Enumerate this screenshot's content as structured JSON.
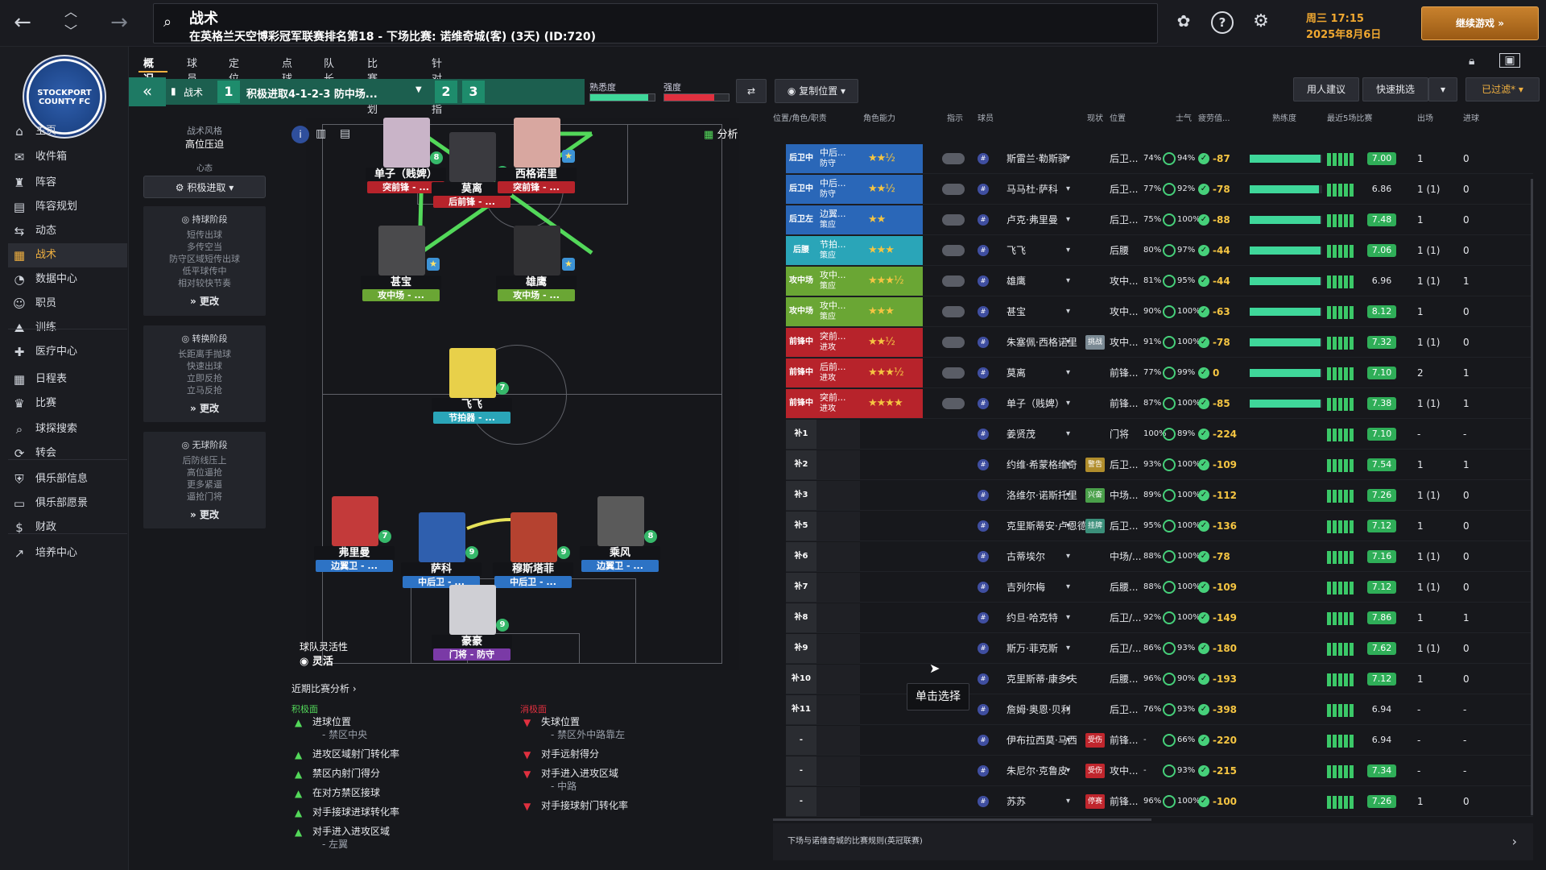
{
  "header": {
    "title": "战术",
    "subtitle": "在英格兰天空博彩冠军联赛排名第18 - 下场比赛: 诺维奇城(客) (3天) (ID:720)",
    "date_line1": "周三 17:15",
    "date_line2": "2025年8月6日",
    "continue_label": "继续游戏"
  },
  "club": {
    "crest_text": "STOCKPORT COUNTY FC"
  },
  "sidebar": {
    "items": [
      {
        "label": "主页",
        "icon": "home-icon"
      },
      {
        "label": "收件箱",
        "icon": "inbox-icon"
      },
      {
        "label": "阵容",
        "icon": "shirt-icon"
      },
      {
        "label": "阵容规划",
        "icon": "clipboard-icon"
      },
      {
        "label": "动态",
        "icon": "dynamics-icon"
      },
      {
        "label": "战术",
        "icon": "tactics-icon"
      },
      {
        "label": "数据中心",
        "icon": "data-icon"
      },
      {
        "label": "职员",
        "icon": "staff-icon"
      },
      {
        "label": "训练",
        "icon": "training-icon"
      },
      {
        "label": "医疗中心",
        "icon": "medical-icon"
      },
      {
        "label": "日程表",
        "icon": "calendar-icon"
      },
      {
        "label": "比赛",
        "icon": "trophy-icon"
      },
      {
        "label": "球探搜索",
        "icon": "search-icon"
      },
      {
        "label": "转会",
        "icon": "transfer-icon"
      },
      {
        "label": "俱乐部信息",
        "icon": "shield-icon"
      },
      {
        "label": "俱乐部愿景",
        "icon": "vision-icon"
      },
      {
        "label": "财政",
        "icon": "finance-icon"
      },
      {
        "label": "培养中心",
        "icon": "development-icon"
      }
    ]
  },
  "tabs": [
    "概况",
    "球员",
    "定位球",
    "点球",
    "队长",
    "比赛计划",
    "针对性指令"
  ],
  "toolbar": {
    "tactic_label": "战术",
    "tactic_name": "积极进取4-1-2-3 防中场...",
    "slot1": "1",
    "slot2": "2",
    "slot3": "3",
    "familiarity_label": "熟悉度",
    "familiarity_level": 0.9,
    "intensity_label": "强度",
    "intensity_level": 0.78,
    "copy_position": "复制位置",
    "advice": "用人建议",
    "quick_pick": "快速挑选",
    "filtered": "已过滤*"
  },
  "tactic_panel": {
    "style_label": "战术风格",
    "style_value": "高位压迫",
    "mentality_label": "心态",
    "mentality_value": "积极进取",
    "in_possession_title": "持球阶段",
    "in_possession": [
      "短传出球",
      "多传空当",
      "防守区域短传出球",
      "低平球传中",
      "相对较快节奏"
    ],
    "transition_title": "转换阶段",
    "transition": [
      "长距离手抛球",
      "快速出球",
      "立即反抢",
      "立马反抢"
    ],
    "out_possession_title": "无球阶段",
    "out_possession": [
      "后防线压上",
      "高位逼抢",
      "更多紧逼",
      "逼抢门将"
    ],
    "more": "更改"
  },
  "pitch": {
    "analysis_label": "分析",
    "flex_label": "球队灵活性",
    "flex_value": "灵活",
    "players": [
      {
        "name": "单子（贱婢）",
        "role": "突前锋 - ...",
        "rating": "8",
        "role_color": "#b7232b"
      },
      {
        "name": "莫离",
        "role": "后前锋 - ...",
        "rating": "8",
        "role_color": "#b7232b"
      },
      {
        "name": "西格诺里",
        "role": "突前锋 - ...",
        "rating": "",
        "role_color": "#b7232b"
      },
      {
        "name": "甚宝",
        "role": "攻中场 - ...",
        "rating": "",
        "role_color": "#6aa634"
      },
      {
        "name": "雄鹰",
        "role": "攻中场 - ...",
        "rating": "",
        "role_color": "#6aa634"
      },
      {
        "name": "飞飞",
        "role": "节拍器 - ...",
        "rating": "7",
        "role_color": "#2aa5b8"
      },
      {
        "name": "弗里曼",
        "role": "边翼卫 - ...",
        "rating": "7",
        "role_color": "#2d73c5"
      },
      {
        "name": "萨科",
        "role": "中后卫 - ...",
        "rating": "9",
        "role_color": "#2d73c5"
      },
      {
        "name": "穆斯塔菲",
        "role": "中后卫 - ...",
        "rating": "9",
        "role_color": "#2d73c5"
      },
      {
        "name": "乘风",
        "role": "边翼卫 - ...",
        "rating": "8",
        "role_color": "#2d73c5"
      },
      {
        "name": "豪豪",
        "role": "门将 - 防守",
        "rating": "9",
        "role_color": "#7a3aa6"
      }
    ]
  },
  "analysis": {
    "title": "近期比赛分析",
    "positive_title": "积极面",
    "negative_title": "消极面",
    "positive": [
      {
        "text": "进球位置",
        "sub": "- 禁区中央"
      },
      {
        "text": "进攻区域射门转化率",
        "sub": ""
      },
      {
        "text": "禁区内射门得分",
        "sub": ""
      },
      {
        "text": "在对方禁区接球",
        "sub": ""
      },
      {
        "text": "对手接球进球转化率",
        "sub": ""
      },
      {
        "text": "对手进入进攻区域",
        "sub": "- 左翼"
      }
    ],
    "negative": [
      {
        "text": "失球位置",
        "sub": "- 禁区外中路靠左"
      },
      {
        "text": "对手远射得分",
        "sub": ""
      },
      {
        "text": "对手进入进攻区域",
        "sub": "- 中路"
      },
      {
        "text": "对手接球射门转化率",
        "sub": ""
      }
    ]
  },
  "table": {
    "headers": {
      "position": "位置/角色/职责",
      "ability": "角色能力",
      "instr": "指示",
      "player": "球员",
      "status": "现状",
      "pos": "位置",
      "morale": "士气",
      "condition": "疲劳值...",
      "familiar": "熟练度",
      "last5": "最近5场比赛",
      "apps": "出场",
      "goals": "进球"
    },
    "rows": [
      {
        "slot": "后卫中右",
        "role": "中后...",
        "duty": "防守",
        "stars": "★★½",
        "player": "斯雷兰·勒斯驿",
        "tag": "",
        "pos": "后卫...",
        "p1": "74%",
        "p2": "94%",
        "form": "-87",
        "rating": "7.00",
        "apps": "1",
        "goals": "0",
        "slot_color": "#2a67b8",
        "fam": 0.98
      },
      {
        "slot": "后卫中左",
        "role": "中后...",
        "duty": "防守",
        "stars": "★★½",
        "player": "马马杜·萨科",
        "tag": "",
        "pos": "后卫...",
        "p1": "77%",
        "p2": "92%",
        "form": "-78",
        "rating": "6.86",
        "apps": "1 (1)",
        "goals": "0",
        "slot_color": "#2a67b8",
        "fam": 0.96
      },
      {
        "slot": "后卫左",
        "role": "边翼...",
        "duty": "策应",
        "stars": "★★",
        "player": "卢克·弗里曼",
        "tag": "",
        "pos": "后卫...",
        "p1": "75%",
        "p2": "100%",
        "form": "-88",
        "rating": "7.48",
        "apps": "1",
        "goals": "0",
        "slot_color": "#2a67b8",
        "fam": 0.98
      },
      {
        "slot": "后腰",
        "role": "节拍...",
        "duty": "策应",
        "stars": "★★★",
        "player": "飞飞",
        "tag": "",
        "pos": "后腰",
        "p1": "80%",
        "p2": "97%",
        "form": "-44",
        "rating": "7.06",
        "apps": "1 (1)",
        "goals": "0",
        "slot_color": "#2aa5b8",
        "fam": 0.98
      },
      {
        "slot": "攻中场右",
        "role": "攻中...",
        "duty": "策应",
        "stars": "★★★½",
        "player": "雄鹰",
        "tag": "",
        "pos": "攻中...",
        "p1": "81%",
        "p2": "95%",
        "form": "-44",
        "rating": "6.96",
        "apps": "1 (1)",
        "goals": "1",
        "slot_color": "#6aa634",
        "fam": 0.98
      },
      {
        "slot": "攻中场左",
        "role": "攻中...",
        "duty": "策应",
        "stars": "★★★",
        "player": "甚宝",
        "tag": "",
        "pos": "攻中...",
        "p1": "90%",
        "p2": "100%",
        "form": "-63",
        "rating": "8.12",
        "apps": "1",
        "goals": "0",
        "slot_color": "#6aa634",
        "fam": 0.98
      },
      {
        "slot": "前锋中右",
        "role": "突前...",
        "duty": "进攻",
        "stars": "★★½",
        "player": "朱塞佩·西格诺里",
        "tag": "挑战",
        "pos": "攻中...",
        "p1": "91%",
        "p2": "100%",
        "form": "-78",
        "rating": "7.32",
        "apps": "1 (1)",
        "goals": "0",
        "slot_color": "#b7232b",
        "fam": 0.98
      },
      {
        "slot": "前锋中",
        "role": "后前...",
        "duty": "进攻",
        "stars": "★★★½",
        "player": "莫离",
        "tag": "",
        "pos": "前锋...",
        "p1": "77%",
        "p2": "99%",
        "form": "0",
        "rating": "7.10",
        "apps": "2",
        "goals": "1",
        "slot_color": "#b7232b",
        "fam": 0.98
      },
      {
        "slot": "前锋中左",
        "role": "突前...",
        "duty": "进攻",
        "stars": "★★★★",
        "player": "单子（贱婢）",
        "tag": "",
        "pos": "前锋...",
        "p1": "87%",
        "p2": "100%",
        "form": "-85",
        "rating": "7.38",
        "apps": "1 (1)",
        "goals": "1",
        "slot_color": "#b7232b",
        "fam": 0.98
      },
      {
        "slot": "补1",
        "role": "",
        "duty": "",
        "stars": "",
        "player": "姜贤茂",
        "tag": "",
        "pos": "门将",
        "p1": "100%",
        "p2": "89%",
        "form": "-224",
        "rating": "7.10",
        "apps": "-",
        "goals": "-",
        "slot_color": "",
        "fam": 0
      },
      {
        "slot": "补2",
        "role": "",
        "duty": "",
        "stars": "",
        "player": "约维·希蒙格维奇",
        "tag": "警告",
        "pos": "后卫...",
        "p1": "93%",
        "p2": "100%",
        "form": "-109",
        "rating": "7.54",
        "apps": "1",
        "goals": "1",
        "slot_color": "",
        "fam": 0
      },
      {
        "slot": "补3",
        "role": "",
        "duty": "",
        "stars": "",
        "player": "洛维尔·诺斯托里",
        "tag": "兴奋",
        "pos": "中场...",
        "p1": "89%",
        "p2": "100%",
        "form": "-112",
        "rating": "7.26",
        "apps": "1 (1)",
        "goals": "0",
        "slot_color": "",
        "fam": 0
      },
      {
        "slot": "补5",
        "role": "",
        "duty": "",
        "stars": "",
        "player": "克里斯蒂安·卢恩德",
        "tag": "挂牌",
        "pos": "后卫...",
        "p1": "95%",
        "p2": "100%",
        "form": "-136",
        "rating": "7.12",
        "apps": "1",
        "goals": "0",
        "slot_color": "",
        "fam": 0
      },
      {
        "slot": "补6",
        "role": "",
        "duty": "",
        "stars": "",
        "player": "古蒂埃尔",
        "tag": "",
        "pos": "中场/...",
        "p1": "88%",
        "p2": "100%",
        "form": "-78",
        "rating": "7.16",
        "apps": "1 (1)",
        "goals": "0",
        "slot_color": "",
        "fam": 0
      },
      {
        "slot": "补7",
        "role": "",
        "duty": "",
        "stars": "",
        "player": "吉列尔梅",
        "tag": "",
        "pos": "后腰...",
        "p1": "88%",
        "p2": "100%",
        "form": "-109",
        "rating": "7.12",
        "apps": "1 (1)",
        "goals": "0",
        "slot_color": "",
        "fam": 0
      },
      {
        "slot": "补8",
        "role": "",
        "duty": "",
        "stars": "",
        "player": "约旦·哈克特",
        "tag": "",
        "pos": "后卫/...",
        "p1": "92%",
        "p2": "100%",
        "form": "-149",
        "rating": "7.86",
        "apps": "1",
        "goals": "1",
        "slot_color": "",
        "fam": 0
      },
      {
        "slot": "补9",
        "role": "",
        "duty": "",
        "stars": "",
        "player": "斯万·菲克斯",
        "tag": "",
        "pos": "后卫/...",
        "p1": "86%",
        "p2": "93%",
        "form": "-180",
        "rating": "7.62",
        "apps": "1 (1)",
        "goals": "0",
        "slot_color": "",
        "fam": 0
      },
      {
        "slot": "补10",
        "role": "",
        "duty": "",
        "stars": "",
        "player": "克里斯蒂·康多夫",
        "tag": "",
        "pos": "后腰...",
        "p1": "96%",
        "p2": "90%",
        "form": "-193",
        "rating": "7.12",
        "apps": "1",
        "goals": "0",
        "slot_color": "",
        "fam": 0
      },
      {
        "slot": "补11",
        "role": "",
        "duty": "",
        "stars": "",
        "player": "詹姆·奥恩·贝利",
        "tag": "",
        "pos": "后卫...",
        "p1": "76%",
        "p2": "93%",
        "form": "-398",
        "rating": "6.94",
        "apps": "-",
        "goals": "-",
        "slot_color": "",
        "fam": 0
      },
      {
        "slot": "-",
        "role": "",
        "duty": "",
        "stars": "",
        "player": "伊布拉西莫·马西",
        "tag": "受伤",
        "pos": "前锋...",
        "p1": "-",
        "p2": "66%",
        "form": "-220",
        "rating": "6.94",
        "apps": "-",
        "goals": "-",
        "slot_color": "",
        "fam": 0
      },
      {
        "slot": "-",
        "role": "",
        "duty": "",
        "stars": "",
        "player": "朱尼尔·克鲁皮",
        "tag": "受伤",
        "pos": "攻中...",
        "p1": "-",
        "p2": "93%",
        "form": "-215",
        "rating": "7.34",
        "apps": "-",
        "goals": "-",
        "slot_color": "",
        "fam": 0
      },
      {
        "slot": "-",
        "role": "",
        "duty": "",
        "stars": "",
        "player": "苏苏",
        "tag": "停赛",
        "pos": "前锋...",
        "p1": "96%",
        "p2": "100%",
        "form": "-100",
        "rating": "7.26",
        "apps": "1",
        "goals": "0",
        "slot_color": "",
        "fam": 0
      }
    ]
  },
  "tooltip": "单击选择",
  "footer": "下场与诺维奇城的比赛规则(英冠联赛)"
}
